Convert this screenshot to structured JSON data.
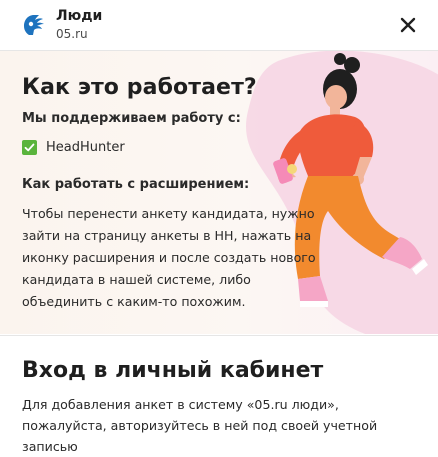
{
  "header": {
    "title": "Люди",
    "subtitle": "05.ru",
    "logo_icon": "hand-logo-icon",
    "close_icon": "close-icon",
    "brand_color": "#1e73be"
  },
  "how_it_works": {
    "title": "Как это работает?",
    "supported_label": "Мы поддерживаем работу с:",
    "supported_items": [
      {
        "label": "HeadHunter",
        "checked": true
      }
    ],
    "instructions_label": "Как работать с расширением:",
    "instructions_lines": [
      "Чтобы перенести анкету кандидата, нужно",
      "зайти на страницу анкеты в НН, нажать на",
      "иконку расширения и после создать нового",
      "кандидата в нашей системе, либо",
      "объединить с каким-то похожим."
    ],
    "accent_color": "#f07a3c"
  },
  "login": {
    "title": "Вход в личный кабинет",
    "text_lines": [
      "Для добавления анкет в систему «05.ru люди»,",
      "пожалуйста, авторизуйтесь в ней под своей учетной",
      "записью"
    ]
  }
}
